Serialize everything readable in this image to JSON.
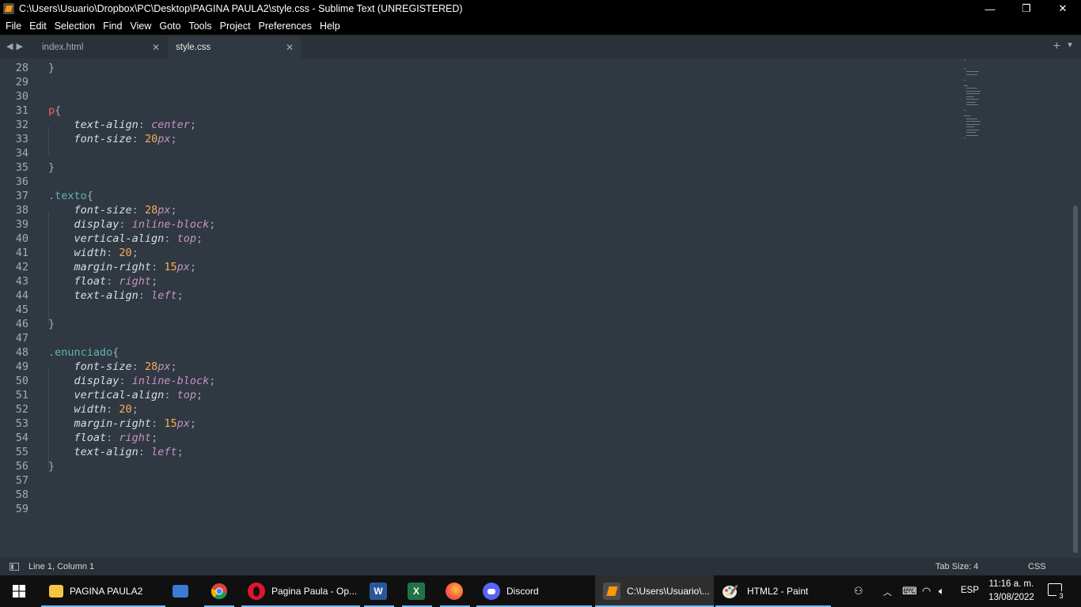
{
  "window": {
    "title": "C:\\Users\\Usuario\\Dropbox\\PC\\Desktop\\PAGINA PAULA2\\style.css - Sublime Text (UNREGISTERED)",
    "controls": {
      "minimize": "—",
      "restore": "❐",
      "close": "✕"
    }
  },
  "menu": [
    "File",
    "Edit",
    "Selection",
    "Find",
    "View",
    "Goto",
    "Tools",
    "Project",
    "Preferences",
    "Help"
  ],
  "tabs": [
    {
      "label": "index.html",
      "active": false
    },
    {
      "label": "style.css",
      "active": true
    }
  ],
  "editor": {
    "lines": [
      {
        "n": "28",
        "tokens": [
          {
            "t": "}",
            "c": "punc"
          }
        ]
      },
      {
        "n": "29",
        "tokens": []
      },
      {
        "n": "30",
        "tokens": []
      },
      {
        "n": "31",
        "tokens": [
          {
            "t": "p",
            "c": "sel"
          },
          {
            "t": "{",
            "c": "punc"
          }
        ]
      },
      {
        "n": "32",
        "tokens": [
          {
            "t": "    "
          },
          {
            "t": "text-align",
            "c": "prop"
          },
          {
            "t": ": ",
            "c": "punc"
          },
          {
            "t": "center",
            "c": "val"
          },
          {
            "t": ";",
            "c": "punc"
          }
        ]
      },
      {
        "n": "33",
        "tokens": [
          {
            "t": "    "
          },
          {
            "t": "font-size",
            "c": "prop"
          },
          {
            "t": ": ",
            "c": "punc"
          },
          {
            "t": "20",
            "c": "num"
          },
          {
            "t": "px",
            "c": "unit"
          },
          {
            "t": ";",
            "c": "punc"
          }
        ]
      },
      {
        "n": "34",
        "tokens": []
      },
      {
        "n": "35",
        "tokens": [
          {
            "t": "}",
            "c": "punc"
          }
        ]
      },
      {
        "n": "36",
        "tokens": []
      },
      {
        "n": "37",
        "tokens": [
          {
            "t": ".texto",
            "c": "cls"
          },
          {
            "t": "{",
            "c": "punc"
          }
        ]
      },
      {
        "n": "38",
        "tokens": [
          {
            "t": "    "
          },
          {
            "t": "font-size",
            "c": "prop"
          },
          {
            "t": ": ",
            "c": "punc"
          },
          {
            "t": "28",
            "c": "num"
          },
          {
            "t": "px",
            "c": "unit"
          },
          {
            "t": ";",
            "c": "punc"
          }
        ]
      },
      {
        "n": "39",
        "tokens": [
          {
            "t": "    "
          },
          {
            "t": "display",
            "c": "prop"
          },
          {
            "t": ": ",
            "c": "punc"
          },
          {
            "t": "inline-block",
            "c": "val"
          },
          {
            "t": ";",
            "c": "punc"
          }
        ]
      },
      {
        "n": "40",
        "tokens": [
          {
            "t": "    "
          },
          {
            "t": "vertical-align",
            "c": "prop"
          },
          {
            "t": ": ",
            "c": "punc"
          },
          {
            "t": "top",
            "c": "val"
          },
          {
            "t": ";",
            "c": "punc"
          }
        ]
      },
      {
        "n": "41",
        "tokens": [
          {
            "t": "    "
          },
          {
            "t": "width",
            "c": "prop"
          },
          {
            "t": ": ",
            "c": "punc"
          },
          {
            "t": "20",
            "c": "num"
          },
          {
            "t": ";",
            "c": "punc"
          }
        ]
      },
      {
        "n": "42",
        "tokens": [
          {
            "t": "    "
          },
          {
            "t": "margin-right",
            "c": "prop"
          },
          {
            "t": ": ",
            "c": "punc"
          },
          {
            "t": "15",
            "c": "num"
          },
          {
            "t": "px",
            "c": "unit"
          },
          {
            "t": ";",
            "c": "punc"
          }
        ]
      },
      {
        "n": "43",
        "tokens": [
          {
            "t": "    "
          },
          {
            "t": "float",
            "c": "prop"
          },
          {
            "t": ": ",
            "c": "punc"
          },
          {
            "t": "right",
            "c": "val"
          },
          {
            "t": ";",
            "c": "punc"
          }
        ]
      },
      {
        "n": "44",
        "tokens": [
          {
            "t": "    "
          },
          {
            "t": "text-align",
            "c": "prop"
          },
          {
            "t": ": ",
            "c": "punc"
          },
          {
            "t": "left",
            "c": "val"
          },
          {
            "t": ";",
            "c": "punc"
          }
        ]
      },
      {
        "n": "45",
        "tokens": []
      },
      {
        "n": "46",
        "tokens": [
          {
            "t": "}",
            "c": "punc"
          }
        ]
      },
      {
        "n": "47",
        "tokens": []
      },
      {
        "n": "48",
        "tokens": [
          {
            "t": ".enunciado",
            "c": "cls"
          },
          {
            "t": "{",
            "c": "punc"
          }
        ]
      },
      {
        "n": "49",
        "tokens": [
          {
            "t": "    "
          },
          {
            "t": "font-size",
            "c": "prop"
          },
          {
            "t": ": ",
            "c": "punc"
          },
          {
            "t": "28",
            "c": "num"
          },
          {
            "t": "px",
            "c": "unit"
          },
          {
            "t": ";",
            "c": "punc"
          }
        ]
      },
      {
        "n": "50",
        "tokens": [
          {
            "t": "    "
          },
          {
            "t": "display",
            "c": "prop"
          },
          {
            "t": ": ",
            "c": "punc"
          },
          {
            "t": "inline-block",
            "c": "val"
          },
          {
            "t": ";",
            "c": "punc"
          }
        ]
      },
      {
        "n": "51",
        "tokens": [
          {
            "t": "    "
          },
          {
            "t": "vertical-align",
            "c": "prop"
          },
          {
            "t": ": ",
            "c": "punc"
          },
          {
            "t": "top",
            "c": "val"
          },
          {
            "t": ";",
            "c": "punc"
          }
        ]
      },
      {
        "n": "52",
        "tokens": [
          {
            "t": "    "
          },
          {
            "t": "width",
            "c": "prop"
          },
          {
            "t": ": ",
            "c": "punc"
          },
          {
            "t": "20",
            "c": "num"
          },
          {
            "t": ";",
            "c": "punc"
          }
        ]
      },
      {
        "n": "53",
        "tokens": [
          {
            "t": "    "
          },
          {
            "t": "margin-right",
            "c": "prop"
          },
          {
            "t": ": ",
            "c": "punc"
          },
          {
            "t": "15",
            "c": "num"
          },
          {
            "t": "px",
            "c": "unit"
          },
          {
            "t": ";",
            "c": "punc"
          }
        ]
      },
      {
        "n": "54",
        "tokens": [
          {
            "t": "    "
          },
          {
            "t": "float",
            "c": "prop"
          },
          {
            "t": ": ",
            "c": "punc"
          },
          {
            "t": "right",
            "c": "val"
          },
          {
            "t": ";",
            "c": "punc"
          }
        ]
      },
      {
        "n": "55",
        "tokens": [
          {
            "t": "    "
          },
          {
            "t": "text-align",
            "c": "prop"
          },
          {
            "t": ": ",
            "c": "punc"
          },
          {
            "t": "left",
            "c": "val"
          },
          {
            "t": ";",
            "c": "punc"
          }
        ]
      },
      {
        "n": "56",
        "tokens": [
          {
            "t": "}",
            "c": "punc"
          }
        ]
      },
      {
        "n": "57",
        "tokens": []
      },
      {
        "n": "58",
        "tokens": []
      },
      {
        "n": "59",
        "tokens": []
      }
    ]
  },
  "status": {
    "position": "Line 1, Column 1",
    "tab_size": "Tab Size: 4",
    "syntax": "CSS"
  },
  "taskbar": {
    "items": [
      {
        "label": "PAGINA PAULA2",
        "icon": "folder-icon"
      },
      {
        "label": "",
        "icon": "control-panel-icon"
      },
      {
        "label": "",
        "icon": "chrome-icon"
      },
      {
        "label": "Pagina Paula - Op...",
        "icon": "opera-icon"
      },
      {
        "label": "",
        "icon": "word-icon"
      },
      {
        "label": "",
        "icon": "excel-icon"
      },
      {
        "label": "",
        "icon": "firefox-icon"
      },
      {
        "label": "Discord",
        "icon": "discord-icon"
      },
      {
        "label": "C:\\Users\\Usuario\\...",
        "icon": "sublime-icon"
      },
      {
        "label": "HTML2 - Paint",
        "icon": "paint-icon"
      }
    ],
    "language": "ESP",
    "time": "11:16 a. m.",
    "date": "13/08/2022",
    "notifications": "3"
  },
  "colors": {
    "editor_bg": "#303841",
    "selector": "#ec5f66",
    "class": "#5fb4b4",
    "value": "#c594c5",
    "number": "#f9ae58"
  }
}
